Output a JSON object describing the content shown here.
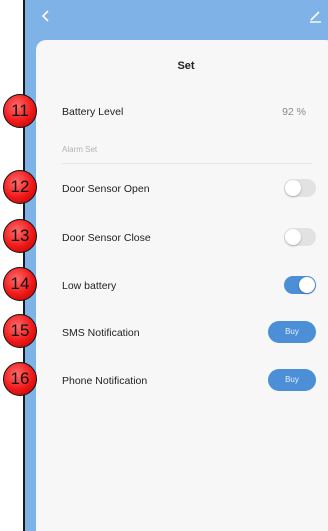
{
  "screen": {
    "title": "Set",
    "battery": {
      "label": "Battery Level",
      "value": "92 %"
    },
    "alarm_section": "Alarm Set",
    "rows": {
      "door_open": {
        "label": "Door Sensor Open",
        "toggle": "off"
      },
      "door_close": {
        "label": "Door Sensor Close",
        "toggle": "off"
      },
      "low_battery": {
        "label": "Low battery",
        "toggle": "on"
      },
      "sms": {
        "label": "SMS Notification",
        "button": "Buy"
      },
      "phone": {
        "label": "Phone Notification",
        "button": "Buy"
      }
    }
  },
  "badges": [
    "11",
    "12",
    "13",
    "14",
    "15",
    "16"
  ],
  "icons": {
    "back": "chevron-left-icon",
    "edit": "pencil-icon"
  },
  "colors": {
    "header": "#7fb2e6",
    "accent": "#4c8fd6",
    "badge": "#f01818"
  }
}
